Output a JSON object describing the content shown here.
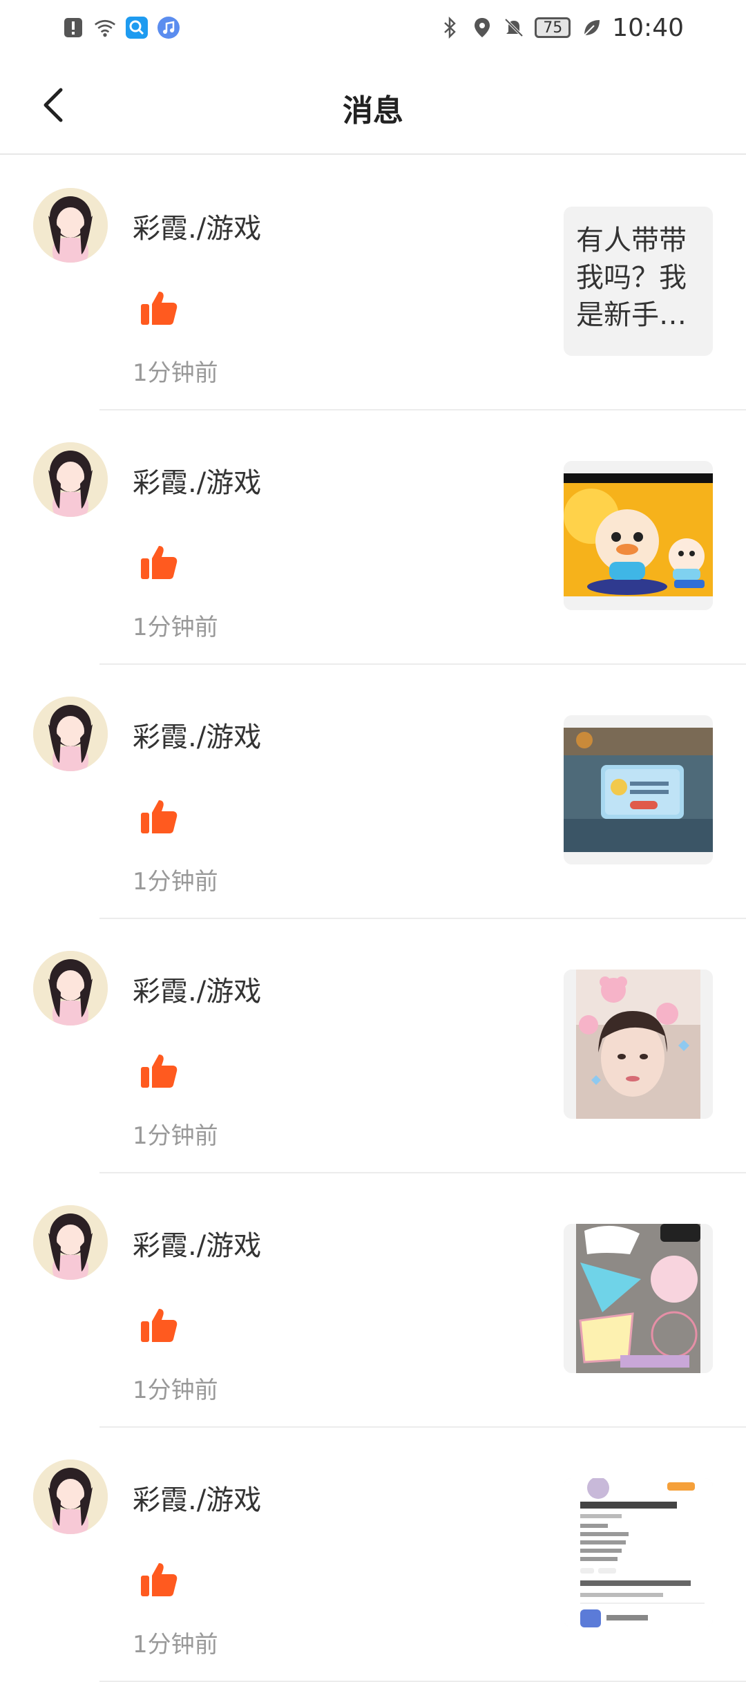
{
  "status_bar": {
    "time": "10:40",
    "battery": "75",
    "left_icons": [
      "alert-icon",
      "wifi-icon",
      "search-app-icon",
      "music-app-icon"
    ],
    "right_icons": [
      "bluetooth-icon",
      "location-icon",
      "mute-icon",
      "battery-icon",
      "leaf-icon"
    ]
  },
  "header": {
    "title": "消息",
    "back_icon": "chevron-left-icon"
  },
  "colors": {
    "accent_orange": "#FF5A1F",
    "divider": "#ececec",
    "muted_text": "#999999"
  },
  "messages": [
    {
      "name": "彩霞./游戏",
      "time": "1分钟前",
      "like_icon": "thumbs-up-icon",
      "thumb_type": "text",
      "thumb_text": "有人带带我吗？我是新手…"
    },
    {
      "name": "彩霞./游戏",
      "time": "1分钟前",
      "like_icon": "thumbs-up-icon",
      "thumb_type": "image",
      "thumb_desc": "game-characters-image"
    },
    {
      "name": "彩霞./游戏",
      "time": "1分钟前",
      "like_icon": "thumbs-up-icon",
      "thumb_type": "image",
      "thumb_desc": "game-screen-image"
    },
    {
      "name": "彩霞./游戏",
      "time": "1分钟前",
      "like_icon": "thumbs-up-icon",
      "thumb_type": "image",
      "thumb_desc": "portrait-photo-image"
    },
    {
      "name": "彩霞./游戏",
      "time": "1分钟前",
      "like_icon": "thumbs-up-icon",
      "thumb_type": "image",
      "thumb_desc": "poster-image"
    },
    {
      "name": "彩霞./游戏",
      "time": "1分钟前",
      "like_icon": "thumbs-up-icon",
      "thumb_type": "image",
      "thumb_desc": "profile-screenshot-image"
    }
  ]
}
